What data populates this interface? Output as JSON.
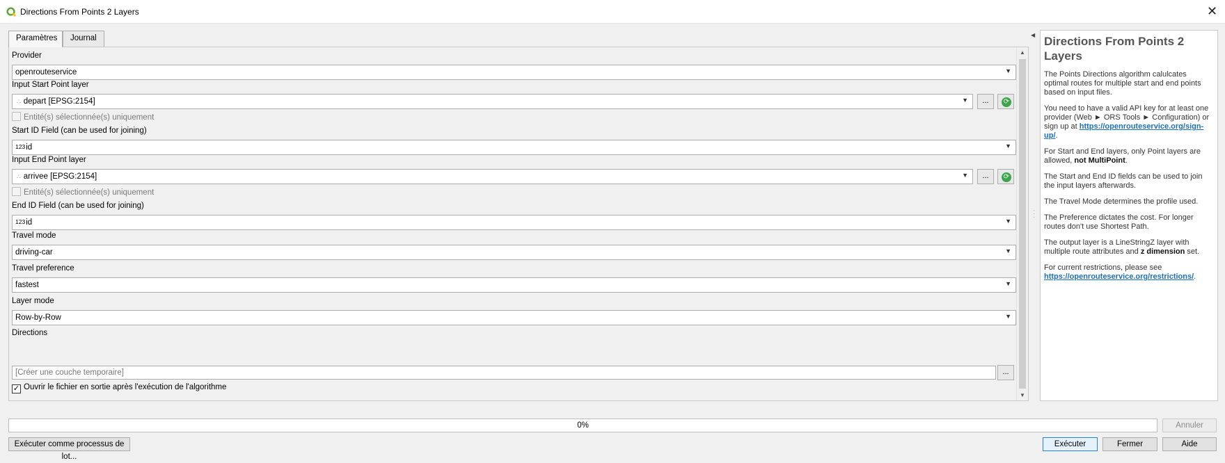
{
  "window": {
    "title": "Directions From Points 2 Layers",
    "close_glyph": "✕",
    "app_icon": "qgis-icon"
  },
  "tabs": [
    {
      "label": "Paramètres",
      "active": true
    },
    {
      "label": "Journal",
      "active": false
    }
  ],
  "params": {
    "provider": {
      "label": "Provider",
      "value": "openrouteservice"
    },
    "start_layer": {
      "label": "Input Start Point layer",
      "value": "depart [EPSG:2154]"
    },
    "start_selected_only": {
      "label": "Entité(s) sélectionnée(s) uniquement",
      "checked": false
    },
    "start_id_field": {
      "label": "Start ID Field (can be used for joining)",
      "type_icon": "123",
      "value": "id"
    },
    "end_layer": {
      "label": "Input End Point layer",
      "value": "arrivee [EPSG:2154]"
    },
    "end_selected_only": {
      "label": "Entité(s) sélectionnée(s) uniquement",
      "checked": false
    },
    "end_id_field": {
      "label": "End ID Field (can be used for joining)",
      "type_icon": "123",
      "value": "id"
    },
    "travel_mode": {
      "label": "Travel mode",
      "value": "driving-car"
    },
    "travel_preference": {
      "label": "Travel preference",
      "value": "fastest"
    },
    "layer_mode": {
      "label": "Layer mode",
      "value": "Row-by-Row"
    },
    "directions": {
      "label": "Directions",
      "placeholder": "[Créer une couche temporaire]"
    },
    "open_output": {
      "label": "Ouvrir le fichier en sortie après l'exécution de l'algorithme",
      "checked": true
    },
    "browse_label": "...",
    "points_icon_glyph": "∴",
    "check_glyph": "✓"
  },
  "help": {
    "title": "Directions From Points 2 Layers",
    "p1": "The Points Directions algorithm calulcates optimal routes for multiple start and end points based on input files.",
    "p2_text": "You need to have a valid API key for at least one provider (Web ► ORS Tools ► Configuration) or sign up at ",
    "p2_link": "https://openrouteservice.org/sign-up/",
    "p3_text": "For Start and End layers, only Point layers are allowed, ",
    "p3_bold": "not MultiPoint",
    "p4": "The Start and End ID fields can be used to join the input layers afterwards.",
    "p5": "The Travel Mode determines the profile used.",
    "p6": "The Preference dictates the cost. For longer routes don't use Shortest Path.",
    "p7_text": "The output layer is a LineStringZ layer with multiple route attributes and ",
    "p7_bold": "z dimension",
    "p7_end": " set.",
    "p8_text": "For current restrictions, please see ",
    "p8_link": "https://openrouteservice.org/restrictions/",
    "period": "."
  },
  "progress": {
    "value": 0,
    "text": "0%"
  },
  "buttons": {
    "cancel": "Annuler",
    "batch": "Exécuter comme processus de lot...",
    "run": "Exécuter",
    "close": "Fermer",
    "help": "Aide"
  },
  "icons": {
    "dropdown": "chevron-down-icon",
    "iterate": "iterate-icon",
    "collapse": "collapse-left-icon"
  },
  "colors": {
    "link": "#1a6fc2",
    "iterate": "#3aa54a",
    "primary_border": "#2a7fd4"
  }
}
